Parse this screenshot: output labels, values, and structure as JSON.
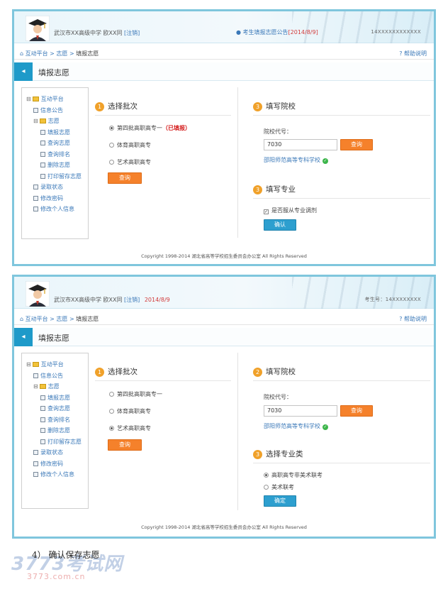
{
  "shot1": {
    "header": {
      "user_name": "武汉市XX高级中学 欧XX同",
      "logout": "[注销]",
      "notice_prefix": "考生填报志愿公告",
      "notice_date": "[2014/8/9]",
      "examinee": "14XXXXXXXXXXXX"
    },
    "breadcrumb": {
      "home": "互动平台",
      "sep": ">",
      "level2": "志愿",
      "current": "填报志愿"
    },
    "help": "帮助说明",
    "page_title": "填报志愿",
    "sidebar": {
      "root": "互动平台",
      "items": [
        "信息公告",
        "志愿",
        "填报志愿",
        "查询志愿",
        "查询排名",
        "删除志愿",
        "打印留存志愿",
        "录取状态",
        "修改密码",
        "修改个人信息"
      ]
    },
    "left_section": {
      "number": "1",
      "title": "选择批次",
      "options": [
        "第四批高职高专一",
        "体育高职高专",
        "艺术高职高专"
      ],
      "reported_tag": "（已填报）",
      "query_button": "查询"
    },
    "right_section": {
      "number": "3",
      "title": "填写院校",
      "code_label": "院校代号：",
      "code_value": "7030",
      "query_button": "查询",
      "school_name": "邵阳师范高等专科学校"
    },
    "major_section": {
      "number": "3",
      "title": "填写专业",
      "adjust_label": "是否服从专业调剂",
      "confirm_button": "确认"
    },
    "footer": "Copyright 1998-2014 湖北省高等学校招生委员会办公室 All Rights Reserved"
  },
  "shot2": {
    "header": {
      "user_name": "武汉市XX高级中学 欧XX同",
      "logout": "[注销]",
      "date": "2014/8/9",
      "examinee_label": "考生号：",
      "examinee": "14XXXXXXXX"
    },
    "breadcrumb": {
      "home": "互动平台",
      "sep": ">",
      "level2": "志愿",
      "current": "填报志愿"
    },
    "help": "帮助说明",
    "page_title": "填报志愿",
    "sidebar": {
      "root": "互动平台",
      "items": [
        "信息公告",
        "志愿",
        "填报志愿",
        "查询志愿",
        "查询排名",
        "删除志愿",
        "打印留存志愿",
        "录取状态",
        "修改密码",
        "修改个人信息"
      ]
    },
    "left_section": {
      "number": "1",
      "title": "选择批次",
      "options": [
        "第四批高职高专一",
        "体育高职高专",
        "艺术高职高专"
      ],
      "query_button": "查询"
    },
    "right_section": {
      "number": "2",
      "title": "填写院校",
      "code_label": "院校代号：",
      "code_value": "7030",
      "query_button": "查询",
      "school_name": "邵阳师范高等专科学校"
    },
    "category_section": {
      "number": "3",
      "title": "选择专业类",
      "options": [
        "高职高专非美术联考",
        "美术联考"
      ],
      "confirm_button": "确定"
    },
    "footer": "Copyright 1998-2014 湖北省高等学校招生委员会办公室 All Rights Reserved"
  },
  "step_caption": "4） 确认保存志愿",
  "watermark": {
    "main": "3773考试网",
    "url": "3773.com.cn"
  },
  "colors": {
    "accent_blue": "#1e9ac9",
    "orange_button": "#f5812b",
    "link_blue": "#3a78b8",
    "red_text": "#d41c1c",
    "frame": "#7fc6dd"
  }
}
